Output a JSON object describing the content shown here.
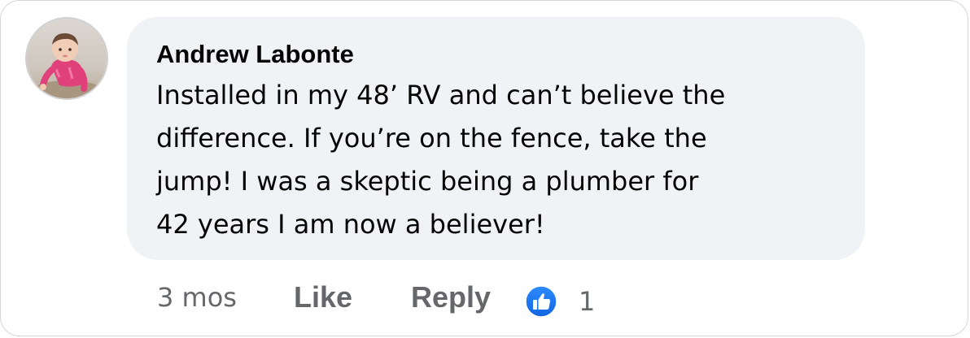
{
  "comment": {
    "author": "Andrew Labonte",
    "lines": [
      "Installed in my 48’ RV and can’t believe the",
      "difference. If you’re on the fence, take the",
      "jump! I was a skeptic being a plumber for",
      "42 years I am now a believer!"
    ]
  },
  "actions": {
    "timestamp": "3 mos",
    "like_label": "Like",
    "reply_label": "Reply",
    "reaction_count": "1",
    "reaction_icon": "thumbs-up-icon",
    "reaction_color": "#1877f2"
  },
  "colors": {
    "bubble_bg": "#f0f2f5",
    "text": "#050505",
    "secondary_text": "#65676b"
  }
}
